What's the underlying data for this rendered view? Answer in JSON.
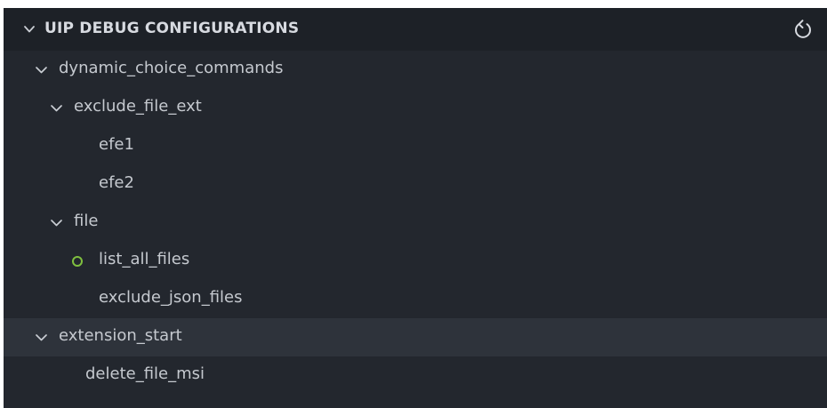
{
  "panel": {
    "title": "UIP DEBUG CONFIGURATIONS",
    "collapse_icon": "chevron-down-icon",
    "refresh_icon": "refresh-icon"
  },
  "colors": {
    "panel_bg": "#23272e",
    "header_bg": "#1d2127",
    "selected_bg": "#2e333b",
    "text": "#c5c9cf",
    "status_dot": "#7fbf3f"
  },
  "tree": {
    "items": [
      {
        "label": "dynamic_choice_commands",
        "expanded": true
      },
      {
        "label": "exclude_file_ext",
        "expanded": true
      },
      {
        "label": "efe1"
      },
      {
        "label": "efe2"
      },
      {
        "label": "file",
        "expanded": true
      },
      {
        "label": "list_all_files",
        "status_icon": "circle-outline-icon",
        "status": "active"
      },
      {
        "label": "exclude_json_files"
      },
      {
        "label": "extension_start",
        "expanded": true,
        "selected": true
      },
      {
        "label": "delete_file_msi"
      }
    ]
  }
}
